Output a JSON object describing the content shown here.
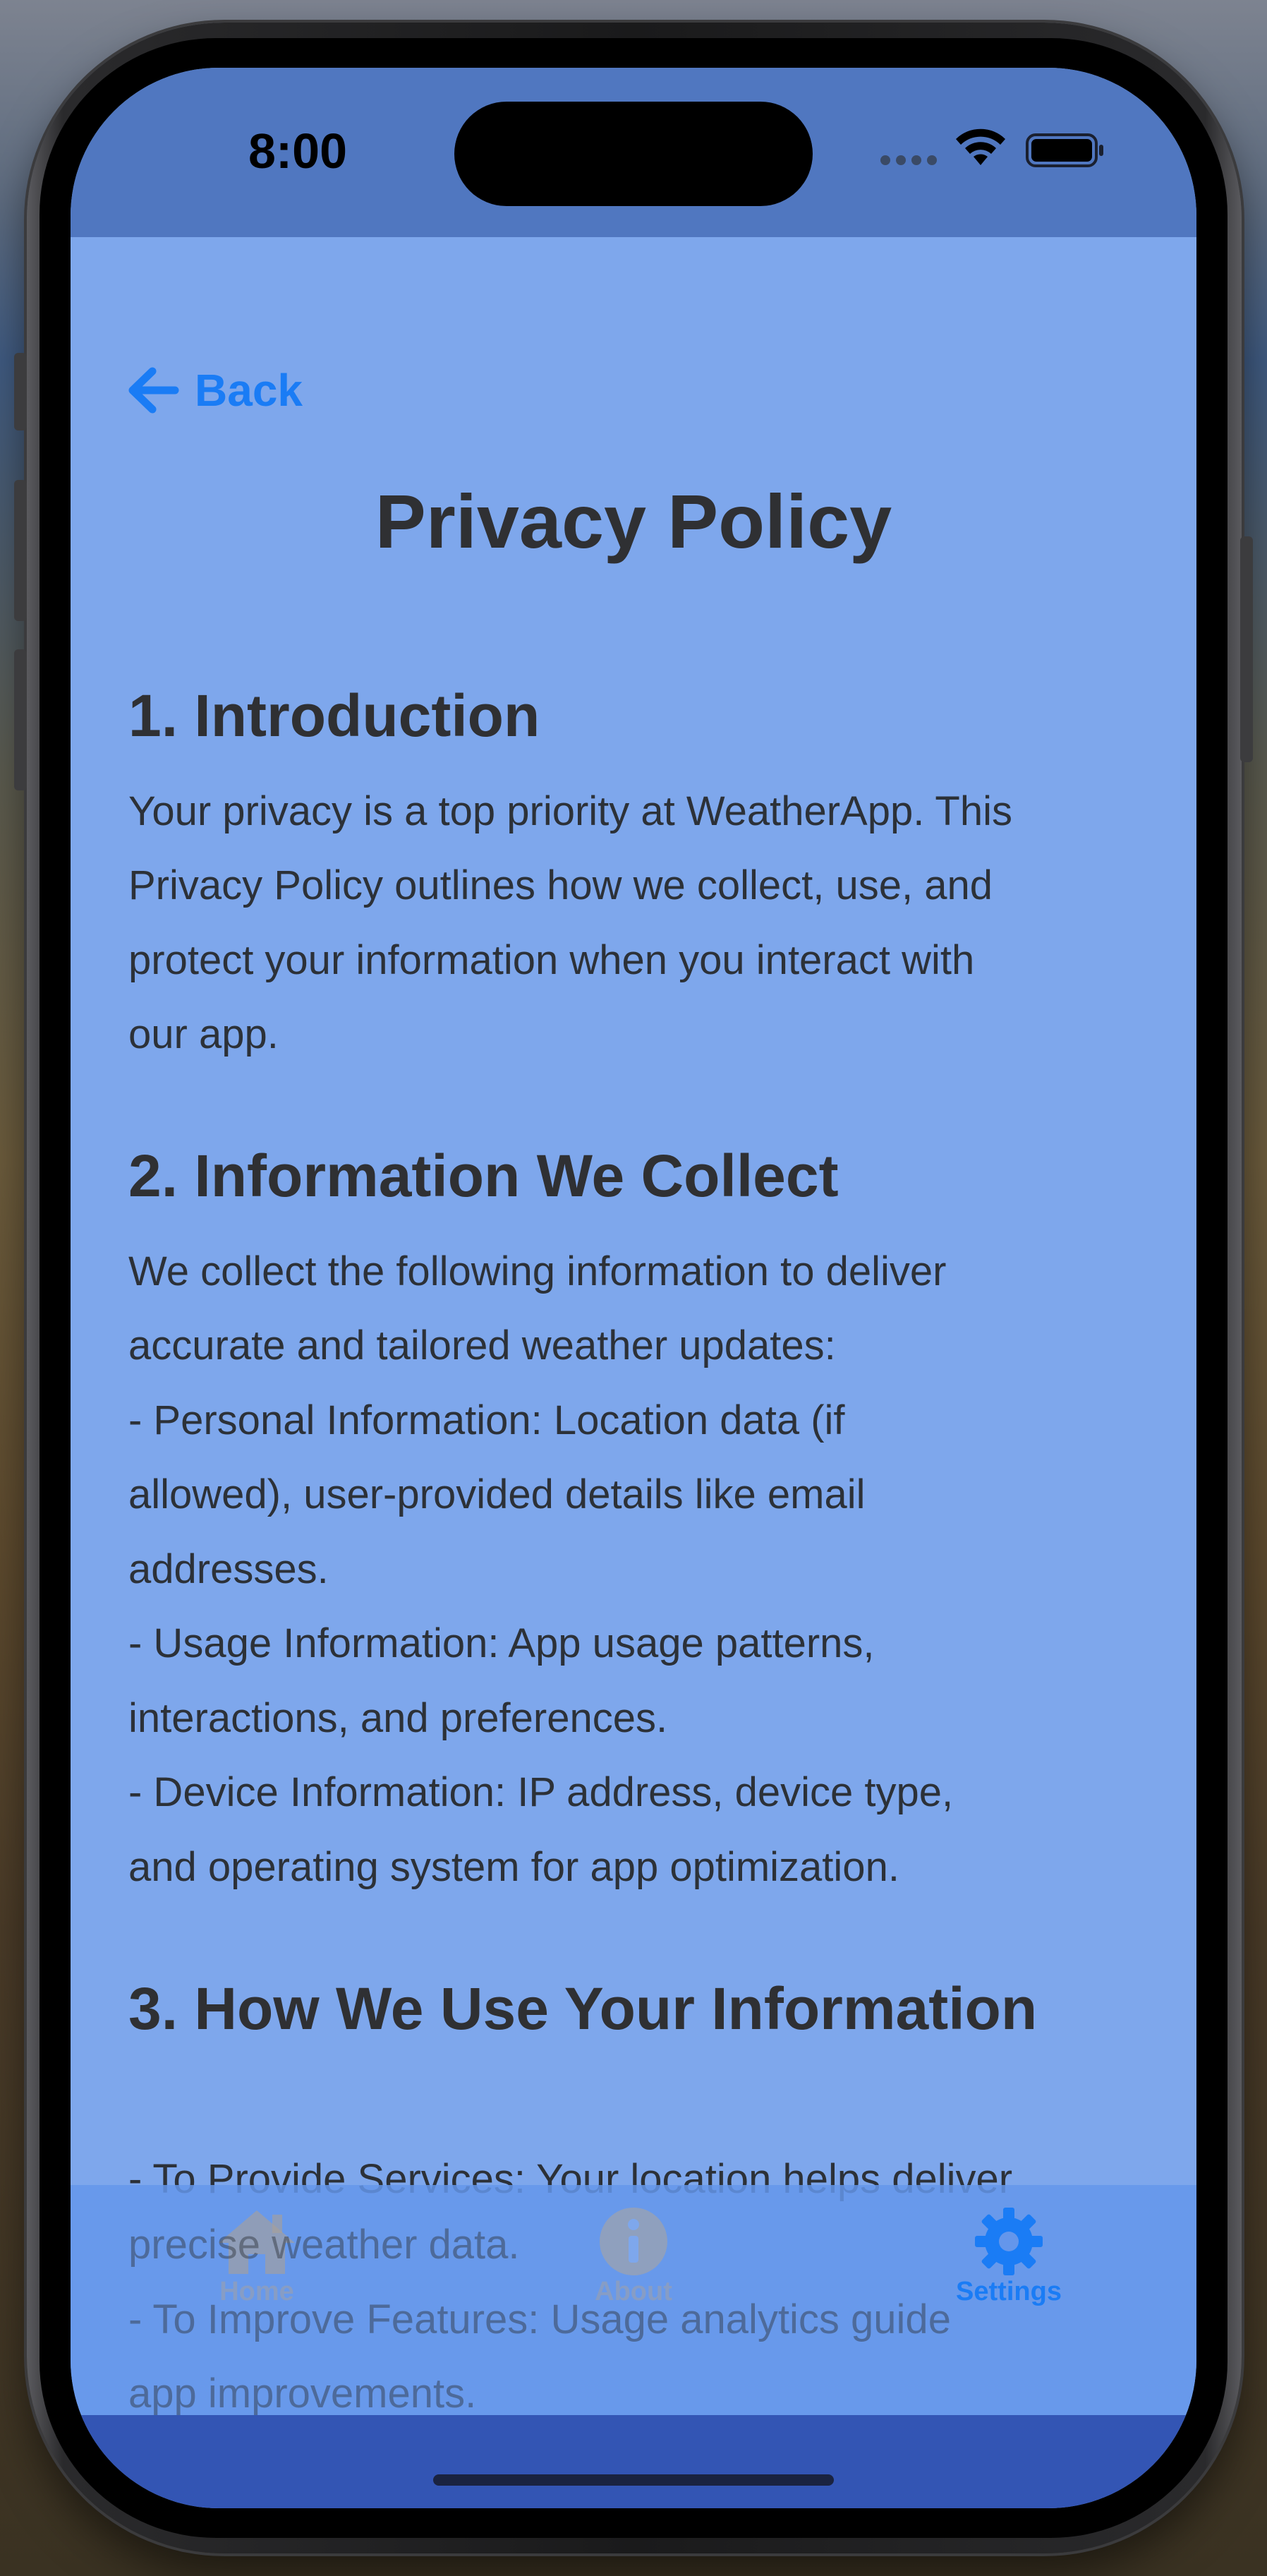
{
  "status_bar": {
    "time": "8:00"
  },
  "nav": {
    "back_label": "Back"
  },
  "page": {
    "title": "Privacy Policy"
  },
  "sections": [
    {
      "heading": "1. Introduction",
      "body": "Your privacy is a top priority at WeatherApp. This\nPrivacy Policy outlines how we collect, use, and\nprotect your information when you interact with\nour app."
    },
    {
      "heading": "2. Information We Collect",
      "body": "We collect the following information to deliver\naccurate and tailored weather updates:\n- Personal Information: Location data (if\nallowed), user-provided details like email\naddresses.\n- Usage Information: App usage patterns,\ninteractions, and preferences.\n- Device Information: IP address, device type,\nand operating system for app optimization."
    },
    {
      "heading": "3. How We Use Your Information",
      "body_visible": "- To Provide Services: Your location helps deliver",
      "body_faded": "precise weather data.\n- To Improve Features: Usage analytics guide\napp improvements."
    }
  ],
  "tab_bar": {
    "items": [
      {
        "label": "Home",
        "icon": "house-icon",
        "active": false
      },
      {
        "label": "About",
        "icon": "info-circle-icon",
        "active": false
      },
      {
        "label": "Settings",
        "icon": "gear-icon",
        "active": true
      }
    ]
  },
  "colors": {
    "accent": "#1a7cf5",
    "background": "#7ea7ec",
    "status_bar": "#5077c0",
    "tab_bar": "#6496eb",
    "bottom_zone": "#3355b4"
  }
}
